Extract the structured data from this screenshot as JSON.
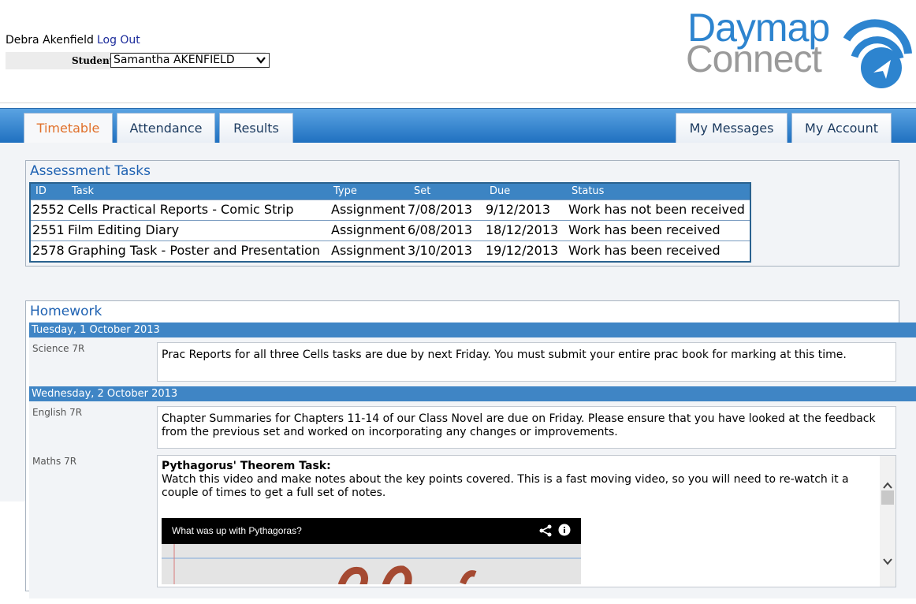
{
  "user": {
    "name": "Debra Akenfield",
    "logout": "Log Out"
  },
  "student": {
    "label": "Student:",
    "selected": "Samantha AKENFIELD"
  },
  "logo": {
    "line1": "Daymap",
    "line2": "Connect"
  },
  "tabs_left": [
    "Timetable",
    "Attendance",
    "Results"
  ],
  "tabs_right": [
    "My Messages",
    "My Account"
  ],
  "assessment": {
    "title": "Assessment Tasks",
    "columns": [
      "ID",
      "Task",
      "Type",
      "Set",
      "Due",
      "Status"
    ],
    "rows": [
      {
        "id": "2552",
        "task": "Cells Practical Reports - Comic Strip",
        "type": "Assignment",
        "set": "7/08/2013",
        "due": "9/12/2013",
        "status": "Work has not been received"
      },
      {
        "id": "2551",
        "task": "Film Editing Diary",
        "type": "Assignment",
        "set": "6/08/2013",
        "due": "18/12/2013",
        "status": "Work has been received"
      },
      {
        "id": "2578",
        "task": "Graphing Task - Poster and Presentation",
        "type": "Assignment",
        "set": "3/10/2013",
        "due": "19/12/2013",
        "status": "Work has been received"
      }
    ]
  },
  "homework": {
    "title": "Homework",
    "days": [
      {
        "date": "Tuesday, 1 October 2013",
        "items": [
          {
            "subject": "Science 7R",
            "text": "Prac Reports for all three Cells tasks are due by next Friday. You must submit your entire prac book for marking at this time."
          }
        ]
      },
      {
        "date": "Wednesday, 2 October 2013",
        "items": [
          {
            "subject": "English 7R",
            "text": "Chapter Summaries for Chapters 11-14 of our Class Novel are due on Friday. Please ensure that you have looked at the feedback from the previous set and worked on incorporating any changes or improvements."
          },
          {
            "subject": "Maths 7R",
            "heading": "Pythagorus' Theorem Task:",
            "text": "Watch this video and make notes about the key points covered. This is a fast moving video, so you will need to re-watch it a couple of times to get a full set of notes.",
            "video_title": "What was up with Pythagoras?"
          }
        ]
      }
    ]
  },
  "colors": {
    "brand_blue": "#2d84cf",
    "tab_active": "#e0702a",
    "header_bar": "#3f85c5"
  },
  "icons": [
    "chevron-down-icon",
    "share-icon",
    "info-icon",
    "scroll-up-icon",
    "scroll-down-icon"
  ]
}
